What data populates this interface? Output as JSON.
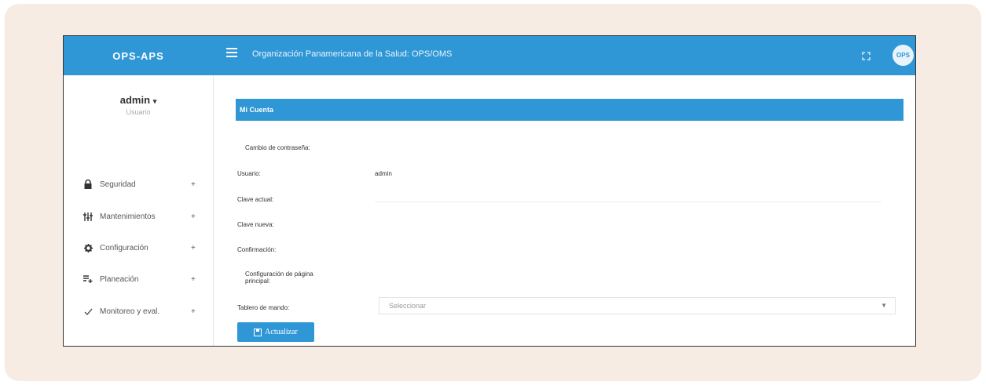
{
  "topbar": {
    "brand": "OPS-APS",
    "org_title": "Organización Panamericana de la Salud: OPS/OMS",
    "avatar_text": "OPS",
    "color": "#2f97d6"
  },
  "user": {
    "name": "admin",
    "role": "Usuario"
  },
  "sidebar": {
    "items": [
      {
        "label": "Seguridad",
        "icon": "lock-icon",
        "expand": "+"
      },
      {
        "label": "Mantenimientos",
        "icon": "sliders-icon",
        "expand": "+"
      },
      {
        "label": "Configuración",
        "icon": "gear-icon",
        "expand": "+"
      },
      {
        "label": "Planeación",
        "icon": "list-plus-icon",
        "expand": "+"
      },
      {
        "label": "Monitoreo y eval.",
        "icon": "check-icon",
        "expand": "+"
      }
    ]
  },
  "account": {
    "title": "Mi Cuenta",
    "section_password": "Cambio de contraseña:",
    "user_label": "Usuario:",
    "user_value": "admin",
    "current_password_label": "Clave actual:",
    "new_password_label": "Clave nueva:",
    "confirmation_label": "Confirmación:",
    "section_home": "Configuración de página principal:",
    "dashboard_label": "Tablero de mando:",
    "dashboard_placeholder": "Seleccionar",
    "update_button": "Actualizar"
  }
}
